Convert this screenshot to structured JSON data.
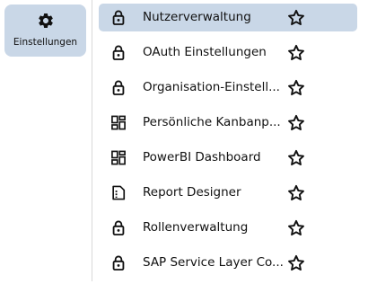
{
  "rail": {
    "button": {
      "label": "Einstellungen",
      "icon": "gear-icon"
    }
  },
  "menu": {
    "items": [
      {
        "label": "Nutzerverwaltung",
        "icon": "lock-icon",
        "active": true
      },
      {
        "label": "OAuth Einstellungen",
        "icon": "lock-icon"
      },
      {
        "label": "Organisation-Einstell...",
        "icon": "lock-icon"
      },
      {
        "label": "Persönliche Kanbanp...",
        "icon": "dashboard-icon"
      },
      {
        "label": "PowerBI Dashboard",
        "icon": "dashboard-icon"
      },
      {
        "label": "Report Designer",
        "icon": "document-icon"
      },
      {
        "label": "Rollenverwaltung",
        "icon": "lock-icon"
      },
      {
        "label": "SAP Service Layer Co...",
        "icon": "lock-icon"
      }
    ],
    "favorite_icon": "star-outline-icon"
  },
  "colors": {
    "active_background": "#c9d7e7",
    "icon": "#111111",
    "divider": "#d9d9d9"
  }
}
